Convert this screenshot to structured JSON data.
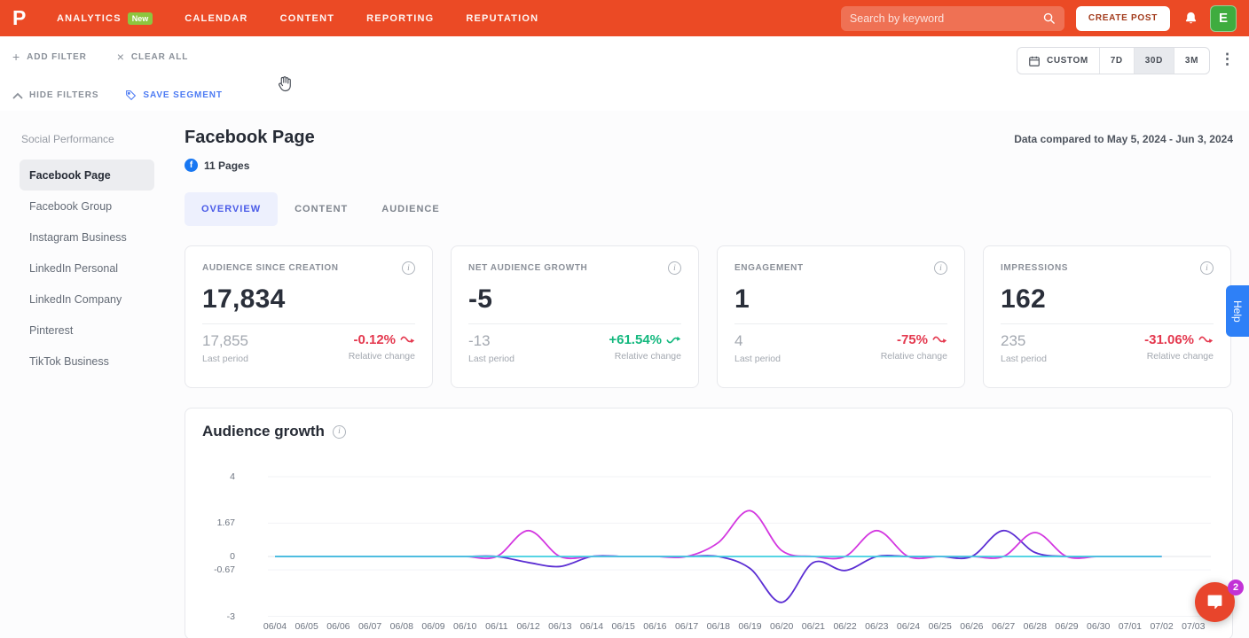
{
  "nav": {
    "logo": "P",
    "items": [
      {
        "label": "ANALYTICS",
        "badge": "New",
        "active": true
      },
      {
        "label": "CALENDAR",
        "active": false
      },
      {
        "label": "CONTENT",
        "active": false
      },
      {
        "label": "REPORTING",
        "active": false
      },
      {
        "label": "REPUTATION",
        "active": false
      }
    ],
    "search": {
      "placeholder": "Search by keyword"
    },
    "create_post_label": "CREATE POST",
    "avatar_initial": "E"
  },
  "filter_bar": {
    "add_filter": "ADD FILTER",
    "clear_all": "CLEAR ALL",
    "hide_filters": "HIDE FILTERS",
    "save_segment": "SAVE SEGMENT",
    "icons": {
      "add": "+",
      "clear": "×",
      "more": "⋮"
    },
    "date_range": {
      "custom_label": "CUSTOM",
      "options": [
        {
          "label": "7D",
          "active": false
        },
        {
          "label": "30D",
          "active": true
        },
        {
          "label": "3M",
          "active": false
        }
      ]
    }
  },
  "sidebar": {
    "header": "Social Performance",
    "items": [
      {
        "label": "Facebook Page",
        "active": true
      },
      {
        "label": "Facebook Group",
        "active": false
      },
      {
        "label": "Instagram Business",
        "active": false
      },
      {
        "label": "LinkedIn Personal",
        "active": false
      },
      {
        "label": "LinkedIn Company",
        "active": false
      },
      {
        "label": "Pinterest",
        "active": false
      },
      {
        "label": "TikTok Business",
        "active": false
      }
    ]
  },
  "main": {
    "title": "Facebook Page",
    "facebook_icon": "f",
    "pages_count": "11 Pages",
    "compare_note": "Data compared to May 5, 2024 - Jun 3, 2024",
    "tabs": [
      {
        "label": "OVERVIEW",
        "active": true
      },
      {
        "label": "CONTENT",
        "active": false
      },
      {
        "label": "AUDIENCE",
        "active": false
      }
    ],
    "stat_cards": [
      {
        "title": "AUDIENCE SINCE CREATION",
        "value": "17,834",
        "last_period_value": "17,855",
        "last_period_label": "Last period",
        "change": "-0.12%",
        "change_label": "Relative change",
        "trend": "down"
      },
      {
        "title": "NET AUDIENCE GROWTH",
        "value": "-5",
        "last_period_value": "-13",
        "last_period_label": "Last period",
        "change": "+61.54%",
        "change_label": "Relative change",
        "trend": "up"
      },
      {
        "title": "ENGAGEMENT",
        "value": "1",
        "last_period_value": "4",
        "last_period_label": "Last period",
        "change": "-75%",
        "change_label": "Relative change",
        "trend": "down"
      },
      {
        "title": "IMPRESSIONS",
        "value": "162",
        "last_period_value": "235",
        "last_period_label": "Last period",
        "change": "-31.06%",
        "change_label": "Relative change",
        "trend": "down"
      }
    ]
  },
  "chart_data": {
    "type": "line",
    "title": "Audience growth",
    "x_labels": [
      "06/04",
      "06/05",
      "06/06",
      "06/07",
      "06/08",
      "06/09",
      "06/10",
      "06/11",
      "06/12",
      "06/13",
      "06/14",
      "06/15",
      "06/16",
      "06/17",
      "06/18",
      "06/19",
      "06/20",
      "06/21",
      "06/22",
      "06/23",
      "06/24",
      "06/25",
      "06/26",
      "06/27",
      "06/28",
      "06/29",
      "06/30",
      "07/01",
      "07/02",
      "07/03"
    ],
    "yticks": [
      4,
      1.67,
      0,
      -0.67,
      -3
    ],
    "ylim": [
      -3,
      4
    ],
    "grid": true,
    "legend": "none",
    "series": [
      {
        "name": "purple-line",
        "color": "#5B2ED3",
        "values": [
          0,
          0,
          0,
          0,
          0,
          0,
          0,
          0,
          -0.3,
          -0.5,
          0,
          0,
          0,
          0,
          0,
          -0.6,
          -2.3,
          -0.3,
          -0.7,
          0,
          0,
          0,
          0,
          1.3,
          0.2,
          0,
          0,
          0,
          0
        ]
      },
      {
        "name": "magenta-line",
        "color": "#D337E0",
        "values": [
          0,
          0,
          0,
          0,
          0,
          0,
          0,
          0,
          1.3,
          0,
          0,
          0,
          0,
          0,
          0.7,
          2.3,
          0.3,
          0,
          0,
          1.3,
          0,
          0,
          0,
          0,
          1.2,
          0,
          0,
          0,
          0
        ]
      },
      {
        "name": "cyan-line",
        "color": "#3ECFE0",
        "values": [
          0,
          0,
          0,
          0,
          0,
          0,
          0,
          0,
          0,
          0,
          0,
          0,
          0,
          0,
          0,
          0,
          0,
          0,
          0,
          0,
          0,
          0,
          0,
          0,
          0,
          0,
          0,
          0,
          0
        ]
      }
    ]
  },
  "help_tab_label": "Help",
  "chat_widget": {
    "unread_count": "2"
  },
  "colors": {
    "brand_orange": "#EB4A25",
    "badge_green": "#8DC63F",
    "avatar_green": "#3FAC3F",
    "facebook_blue": "#1877F2",
    "tab_active_blue": "#4A5BE8",
    "link_blue": "#4D7BF3",
    "negative_red": "#E4384E",
    "positive_green": "#13B87E",
    "help_blue": "#2E80F7",
    "chat_red": "#E8452C",
    "chat_badge_purple": "#C232D6"
  }
}
